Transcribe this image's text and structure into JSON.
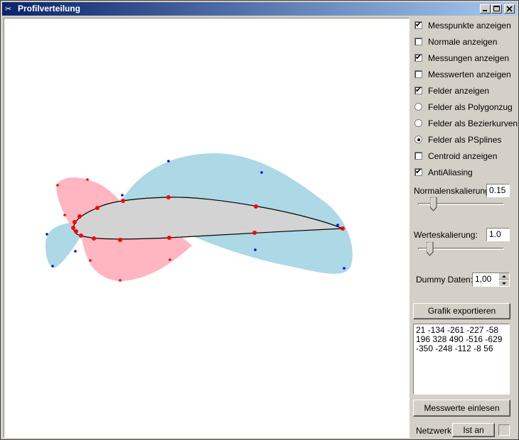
{
  "window": {
    "title": "Profilverteilung",
    "controls": {
      "minimize": "_",
      "maximize": "□",
      "close": "×"
    }
  },
  "options": [
    {
      "label": "Messpunkte anzeigen",
      "type": "checkbox",
      "checked": true
    },
    {
      "label": "Normale anzeigen",
      "type": "checkbox",
      "checked": false
    },
    {
      "label": "Messungen anzeigen",
      "type": "checkbox",
      "checked": true
    },
    {
      "label": "Messwerten anzeigen",
      "type": "checkbox",
      "checked": false
    },
    {
      "label": "Felder anzeigen",
      "type": "checkbox",
      "checked": true
    },
    {
      "label": "Felder als Polygonzug",
      "type": "radio",
      "checked": false
    },
    {
      "label": "Felder als Bezierkurven",
      "type": "radio",
      "checked": false
    },
    {
      "label": "Felder als PSplines",
      "type": "radio",
      "checked": true
    },
    {
      "label": "Centroid anzeigen",
      "type": "checkbox",
      "checked": false
    },
    {
      "label": "AntiAliasing",
      "type": "checkbox",
      "checked": true
    }
  ],
  "normal_scale": {
    "label": "Normalenskalierung:",
    "value": "0.15",
    "slider_fraction": 0.15
  },
  "value_scale": {
    "label": "Werteskalierung:",
    "value": "1.0",
    "slider_fraction": 0.1
  },
  "dummy": {
    "label": "Dummy Daten:",
    "value": "1,00"
  },
  "buttons": {
    "export": "Grafik exportieren",
    "read_values": "Messwerte einlesen",
    "network_state": "Ist an"
  },
  "measurements_text": "21 -134 -261 -227 -58 196 328 490 -516 -629 -350 -248 -112 -8 56",
  "network": {
    "label": "Netzwerk:",
    "checked": false
  },
  "colors": {
    "positive_field": "#add8e6",
    "negative_field": "#ffb6c1",
    "profile_fill": "#d3d3d3",
    "measure_point": "#ff0000",
    "control_blue": "#0000ff",
    "control_red": "#ff0000"
  }
}
